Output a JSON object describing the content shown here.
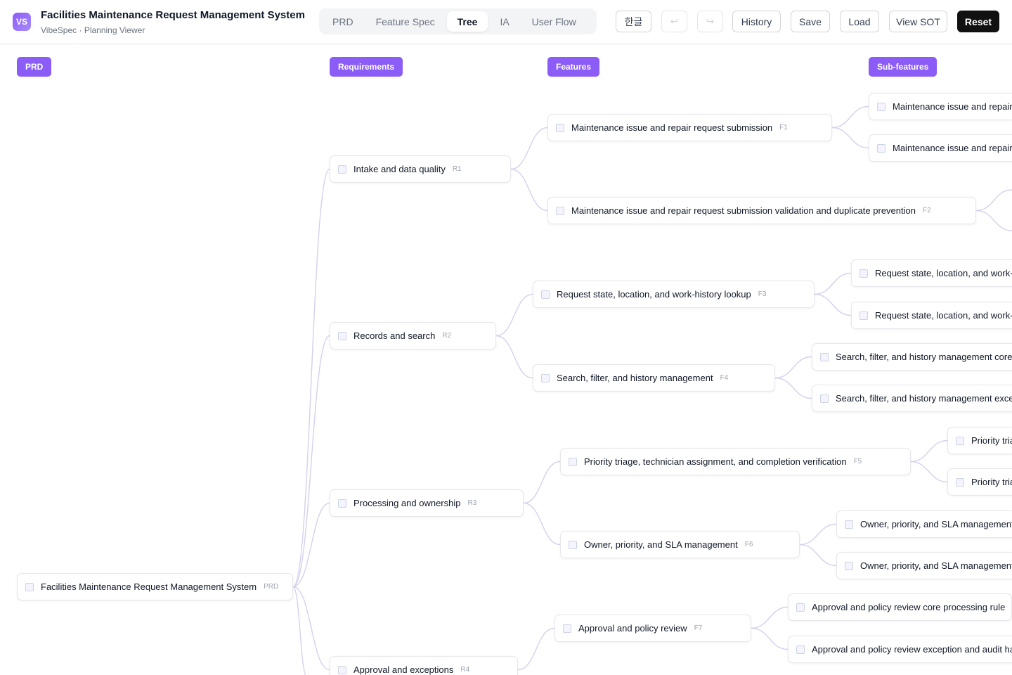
{
  "app": {
    "logo": "VS",
    "title": "Facilities Maintenance Request Management System",
    "subtitle": "VibeSpec · Planning Viewer"
  },
  "tabs": [
    "PRD",
    "Feature Spec",
    "Tree",
    "IA",
    "User Flow"
  ],
  "active_tab": "Tree",
  "toolbar": {
    "language": "한글",
    "undo_icon": "undo-icon",
    "redo_icon": "redo-icon",
    "undo_glyph": "↩",
    "redo_glyph": "↪",
    "history": "History",
    "save": "Save",
    "load": "Load",
    "view_sot": "View SOT",
    "reset": "Reset"
  },
  "columns": {
    "prd": "PRD",
    "requirements": "Requirements",
    "features": "Features",
    "subfeatures": "Sub-features"
  },
  "colors": {
    "accent": "#8b5cf6",
    "edge": "#d6d0ee"
  },
  "tree": {
    "root": {
      "label": "Facilities Maintenance Request Management System",
      "code": "PRD"
    },
    "requirements": [
      {
        "label": "Intake and data quality",
        "code": "R1"
      },
      {
        "label": "Records and search",
        "code": "R2"
      },
      {
        "label": "Processing and ownership",
        "code": "R3"
      },
      {
        "label": "Approval and exceptions",
        "code": "R4"
      }
    ],
    "features": [
      {
        "label": "Maintenance issue and repair request submission",
        "code": "F1"
      },
      {
        "label": "Maintenance issue and repair request submission validation and duplicate prevention",
        "code": "F2"
      },
      {
        "label": "Request state, location, and work-history lookup",
        "code": "F3"
      },
      {
        "label": "Search, filter, and history management",
        "code": "F4"
      },
      {
        "label": "Priority triage, technician assignment, and completion verification",
        "code": "F5"
      },
      {
        "label": "Owner, priority, and SLA management",
        "code": "F6"
      },
      {
        "label": "Approval and policy review",
        "code": "F7"
      }
    ],
    "subfeatures": [
      {
        "label": "Maintenance issue and repair"
      },
      {
        "label": "Maintenance issue and repair"
      },
      {
        "label": "Request state, location, and work-h"
      },
      {
        "label": "Request state, location, and work-h"
      },
      {
        "label": "Search, filter, and history management core"
      },
      {
        "label": "Search, filter, and history management excep"
      },
      {
        "label": "Priority tria"
      },
      {
        "label": "Priority tria"
      },
      {
        "label": "Owner, priority, and SLA management"
      },
      {
        "label": "Owner, priority, and SLA management"
      },
      {
        "label": "Approval and policy review core processing rule"
      },
      {
        "label": "Approval and policy review exception and audit ha"
      }
    ]
  }
}
